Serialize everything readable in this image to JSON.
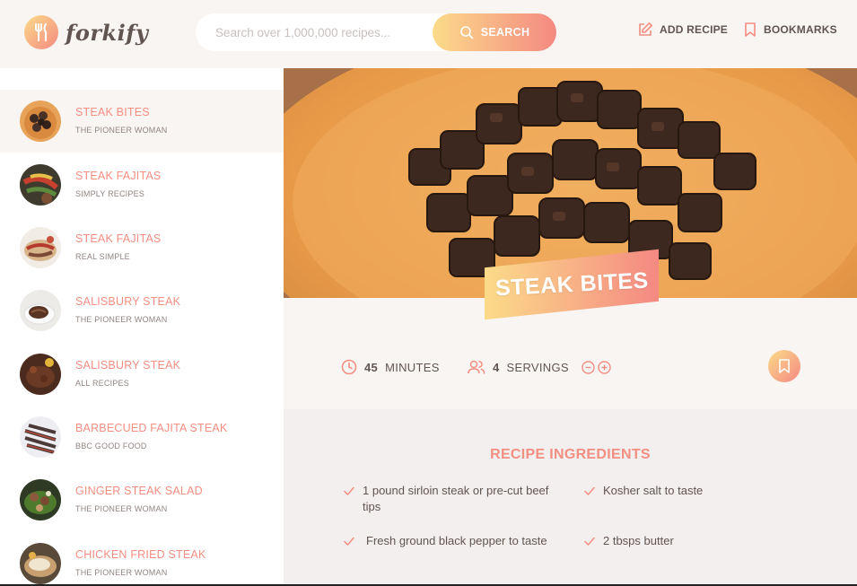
{
  "header": {
    "logo_text": "forkify",
    "search_placeholder": "Search over 1,000,000 recipes...",
    "search_button": "SEARCH",
    "add_recipe": "ADD RECIPE",
    "bookmarks": "BOOKMARKS"
  },
  "results": [
    {
      "title": "STEAK BITES",
      "publisher": "THE PIONEER WOMAN",
      "active": true
    },
    {
      "title": "STEAK FAJITAS",
      "publisher": "SIMPLY RECIPES"
    },
    {
      "title": "STEAK FAJITAS",
      "publisher": "REAL SIMPLE"
    },
    {
      "title": "SALISBURY STEAK",
      "publisher": "THE PIONEER WOMAN"
    },
    {
      "title": "SALISBURY STEAK",
      "publisher": "ALL RECIPES"
    },
    {
      "title": "BARBECUED FAJITA STEAK",
      "publisher": "BBC GOOD FOOD"
    },
    {
      "title": "GINGER STEAK SALAD",
      "publisher": "THE PIONEER WOMAN"
    },
    {
      "title": "CHICKEN FRIED STEAK",
      "publisher": "THE PIONEER WOMAN"
    }
  ],
  "recipe": {
    "title": "STEAK BITES",
    "minutes": "45",
    "minutes_label": "MINUTES",
    "servings": "4",
    "servings_label": "SERVINGS",
    "ingredients_heading": "RECIPE INGREDIENTS",
    "ingredients": [
      "1 pound sirloin steak or pre-cut beef tips",
      "Kosher salt to taste",
      "Fresh ground black pepper to taste",
      "2 tbsps butter"
    ]
  },
  "colors": {
    "accent": "#f38e82",
    "gradient_start": "#fbdb89",
    "gradient_end": "#f48982",
    "text": "#615551",
    "background": "#f9f5f3"
  },
  "icons": {
    "logo": "fork-knife-icon",
    "search": "search-icon",
    "add_recipe": "edit-icon",
    "bookmarks": "bookmark-icon",
    "time": "clock-icon",
    "servings": "users-icon",
    "decrease": "minus-circle-icon",
    "increase": "plus-circle-icon",
    "ingredient": "check-icon"
  }
}
